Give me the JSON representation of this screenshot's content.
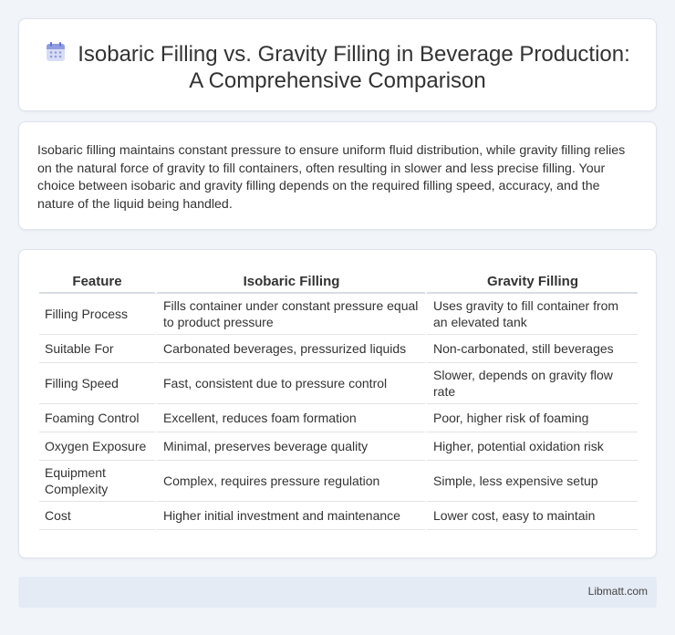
{
  "title": {
    "icon": "calendar-icon",
    "line1": "Isobaric Filling vs. Gravity Filling in Beverage Production:",
    "line2": "A Comprehensive Comparison"
  },
  "intro": "Isobaric filling maintains constant pressure to ensure uniform fluid distribution, while gravity filling relies on the natural force of gravity to fill containers, often resulting in slower and less precise filling. Your choice between isobaric and gravity filling depends on the required filling speed, accuracy, and the nature of the liquid being handled.",
  "table": {
    "headers": [
      "Feature",
      "Isobaric Filling",
      "Gravity Filling"
    ],
    "rows": [
      [
        "Filling Process",
        "Fills container under constant pressure equal to product pressure",
        "Uses gravity to fill container from an elevated tank"
      ],
      [
        "Suitable For",
        "Carbonated beverages, pressurized liquids",
        "Non-carbonated, still beverages"
      ],
      [
        "Filling Speed",
        "Fast, consistent due to pressure control",
        "Slower, depends on gravity flow rate"
      ],
      [
        "Foaming Control",
        "Excellent, reduces foam formation",
        "Poor, higher risk of foaming"
      ],
      [
        "Oxygen Exposure",
        "Minimal, preserves beverage quality",
        "Higher, potential oxidation risk"
      ],
      [
        "Equipment Complexity",
        "Complex, requires pressure regulation",
        "Simple, less expensive setup"
      ],
      [
        "Cost",
        "Higher initial investment and maintenance",
        "Lower cost, easy to maintain"
      ]
    ]
  },
  "footer": "Libmatt.com"
}
